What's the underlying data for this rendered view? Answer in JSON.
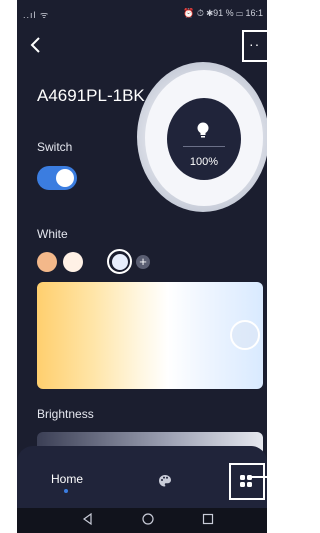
{
  "status_bar": {
    "left": "..ıl ᯤ",
    "right": "⏰ ⏱ ✱91 % ▭ 16:1"
  },
  "header": {
    "back_icon": "chevron-left-icon",
    "more_icon": "more-dots-icon",
    "more_label": "··"
  },
  "device": {
    "title": "A4691PL-1BK",
    "brightness_percent": "100%",
    "brightness_level": 1.0
  },
  "switch": {
    "label": "Switch",
    "state": "on",
    "color": "#3b7de0"
  },
  "white": {
    "label": "White",
    "swatches": [
      "#f3b88a",
      "#fff1e6",
      "#e8eefc"
    ],
    "selected_index": 2,
    "add_label": "+"
  },
  "brightness": {
    "label": "Brightness"
  },
  "tabs": {
    "home_label": "Home",
    "palette_icon": "palette-icon",
    "scenes_icon": "grid-icon"
  },
  "nav": {
    "back_icon": "triangle-back-icon",
    "home_icon": "circle-home-icon",
    "recent_icon": "square-recent-icon"
  }
}
